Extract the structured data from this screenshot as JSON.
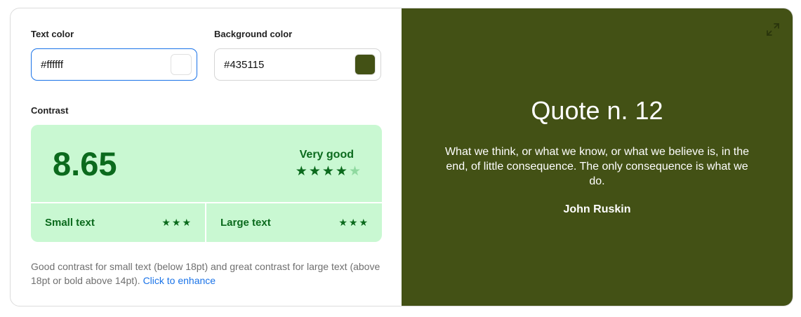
{
  "text_color": {
    "label": "Text color",
    "value": "#ffffff",
    "swatch": "#ffffff"
  },
  "background_color": {
    "label": "Background color",
    "value": "#435115",
    "swatch": "#435115"
  },
  "contrast": {
    "label": "Contrast",
    "ratio": "8.65",
    "rating": "Very good",
    "stars_filled": 4,
    "stars_total": 5,
    "small_text": {
      "label": "Small text",
      "stars": 3
    },
    "large_text": {
      "label": "Large text",
      "stars": 3
    },
    "description": "Good contrast for small text (below 18pt) and great contrast for large text (above 18pt or bold above 14pt).",
    "enhance_link": "Click to enhance",
    "colors": {
      "good_bg": "#c9f8d2",
      "good_fg": "#0b6a1d",
      "dim_star": "#8fd9a0"
    }
  },
  "preview": {
    "title": "Quote n. 12",
    "text": "What we think, or what we know, or what we believe is, in the end, of little consequence. The only consequence is what we do.",
    "author": "John Ruskin",
    "expand_icon": "expand-arrows-icon"
  }
}
